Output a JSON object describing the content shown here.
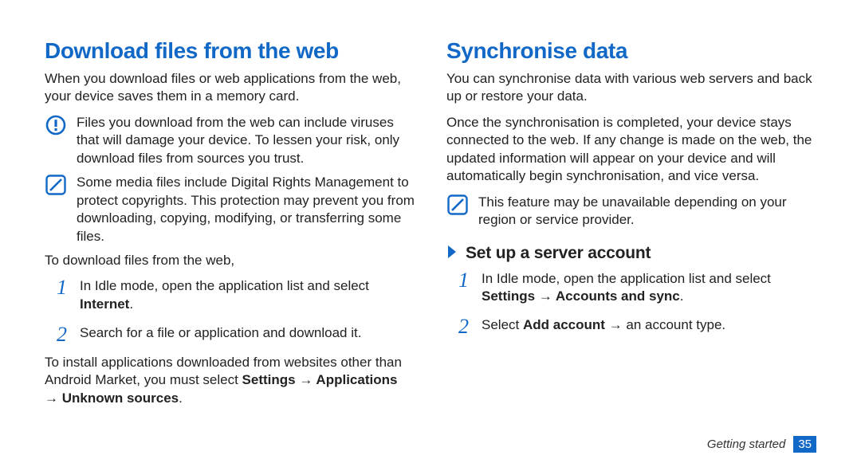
{
  "left": {
    "title": "Download files from the web",
    "intro": "When you download files or web applications from the web, your device saves them in a memory card.",
    "warn": "Files you download from the web can include viruses that will damage your device. To lessen your risk, only download files from sources you trust.",
    "note": "Some media files include Digital Rights Management to protect copyrights. This protection may prevent you from downloading, copying, modifying, or transferring some files.",
    "lead": "To download files from the web,",
    "step1_a": "In Idle mode, open the application list and select ",
    "step1_b": "Internet",
    "step1_c": ".",
    "step2": "Search for a file or application and download it.",
    "tail_a": "To install applications downloaded from websites other than Android Market, you must select ",
    "tail_b": "Settings → Applications → Unknown sources",
    "tail_c": "."
  },
  "right": {
    "title": "Synchronise data",
    "p1": "You can synchronise data with various web servers and back up or restore your data.",
    "p2": "Once the synchronisation is completed, your device stays connected to the web. If any change is made on the web, the updated information will appear on your device and will automatically begin synchronisation, and vice versa.",
    "note": "This feature may be unavailable depending on your region or service provider.",
    "sub": "Set up a server account",
    "step1_a": "In Idle mode, open the application list and select ",
    "step1_b": "Settings → Accounts and sync",
    "step1_c": ".",
    "step2_a": "Select ",
    "step2_b": "Add account",
    "step2_c": " → an account type."
  },
  "nums": {
    "n1": "1",
    "n2": "2"
  },
  "footer": {
    "section": "Getting started",
    "page": "35"
  }
}
